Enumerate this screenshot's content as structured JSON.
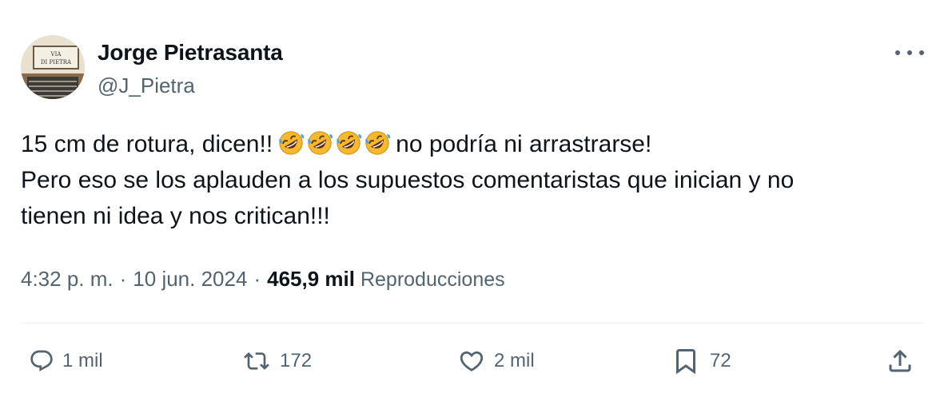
{
  "author": {
    "name": "Jorge Pietrasanta",
    "handle": "@J_Pietra",
    "avatar_sign_text": [
      "VIA",
      "DI PIETRA"
    ]
  },
  "tweet": {
    "line1_before": "15 cm de rotura, dicen!!",
    "emoji": "🤣",
    "emoji_count": 4,
    "line1_after": "no podría ni arrastrarse!",
    "line2": "Pero eso se los aplauden a los supuestos comentaristas que inician y no",
    "line3": "tienen ni idea y nos critican!!!"
  },
  "meta": {
    "time": "4:32 p. m.",
    "separator": "·",
    "date": "10 jun. 2024",
    "views_count": "465,9 mil",
    "views_label": "Reproducciones"
  },
  "actions": {
    "replies": "1 mil",
    "reposts": "172",
    "likes": "2 mil",
    "bookmarks": "72"
  },
  "icons": {
    "more": "more-horizontal-icon",
    "reply": "reply-icon",
    "repost": "repost-icon",
    "like": "heart-icon",
    "bookmark": "bookmark-icon",
    "share": "share-icon"
  },
  "colors": {
    "text": "#0f1419",
    "secondary": "#536471",
    "divider": "#eff3f4"
  }
}
